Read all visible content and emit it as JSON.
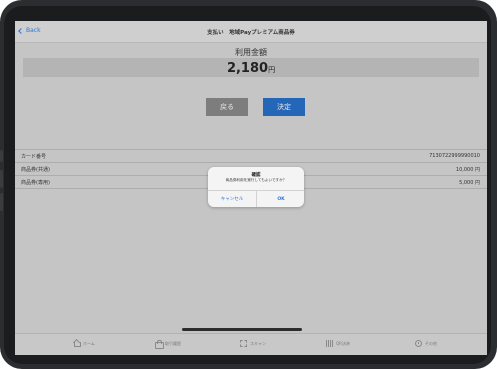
{
  "nav": {
    "back_label": "Back",
    "title": "支払い　地域Payプレミアム商品券"
  },
  "amount": {
    "label": "利用金額",
    "value": "2,180",
    "unit": "円"
  },
  "buttons": {
    "back_label": "戻る",
    "confirm_label": "決定"
  },
  "details": [
    {
      "key": "カード番号",
      "value": "7130722999990010"
    },
    {
      "key": "商品券(共通)",
      "value": "10,000 円"
    },
    {
      "key": "商品券(専用)",
      "value": "5,000 円"
    }
  ],
  "alert": {
    "title": "確認",
    "message": "商品券利用を実行してもよいですか？",
    "cancel_label": "キャンセル",
    "ok_label": "OK"
  },
  "tabbar": [
    {
      "label": "ホーム",
      "icon": "home-icon"
    },
    {
      "label": "取引履歴",
      "icon": "bag-icon"
    },
    {
      "label": "スキャン",
      "icon": "scan-icon"
    },
    {
      "label": "QR決済",
      "icon": "qr-icon"
    },
    {
      "label": "その他",
      "icon": "clock-icon"
    }
  ],
  "colors": {
    "accent": "#2466b8",
    "link": "#2b78d8",
    "dim_background": "#c5c5c5"
  }
}
